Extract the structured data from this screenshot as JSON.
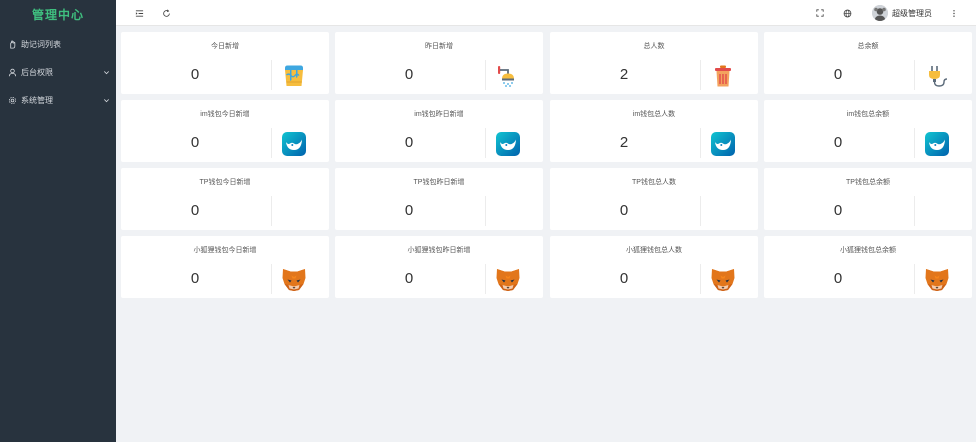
{
  "sidebar": {
    "brand": "管理中心",
    "items": [
      {
        "label": "助记词列表",
        "icon": "hand-icon",
        "has_children": false
      },
      {
        "label": "后台权限",
        "icon": "user-icon",
        "has_children": true
      },
      {
        "label": "系统管理",
        "icon": "gear-icon",
        "has_children": true
      }
    ]
  },
  "header": {
    "left_icons": [
      "menu-fold-icon",
      "refresh-icon"
    ],
    "right_icons": [
      "fullscreen-icon",
      "language-icon",
      "more-icon"
    ],
    "username": "超级管理员"
  },
  "cards": [
    {
      "title": "今日新增",
      "value": "0",
      "icon": "paint-bucket-icon"
    },
    {
      "title": "昨日新增",
      "value": "0",
      "icon": "shower-icon"
    },
    {
      "title": "总人数",
      "value": "2",
      "icon": "trash-bin-icon"
    },
    {
      "title": "总余额",
      "value": "0",
      "icon": "plug-icon"
    },
    {
      "title": "im钱包今日新增",
      "value": "0",
      "icon": "imtoken-icon"
    },
    {
      "title": "im钱包昨日新增",
      "value": "0",
      "icon": "imtoken-icon"
    },
    {
      "title": "im钱包总人数",
      "value": "2",
      "icon": "imtoken-icon"
    },
    {
      "title": "im钱包总余额",
      "value": "0",
      "icon": "imtoken-icon"
    },
    {
      "title": "TP钱包今日新增",
      "value": "0",
      "icon": ""
    },
    {
      "title": "TP钱包昨日新增",
      "value": "0",
      "icon": ""
    },
    {
      "title": "TP钱包总人数",
      "value": "0",
      "icon": ""
    },
    {
      "title": "TP钱包总余额",
      "value": "0",
      "icon": ""
    },
    {
      "title": "小狐狸钱包今日新增",
      "value": "0",
      "icon": "metamask-fox-icon"
    },
    {
      "title": "小狐狸钱包昨日新增",
      "value": "0",
      "icon": "metamask-fox-icon"
    },
    {
      "title": "小狐狸钱包总人数",
      "value": "0",
      "icon": "metamask-fox-icon"
    },
    {
      "title": "小狐狸钱包总余额",
      "value": "0",
      "icon": "metamask-fox-icon"
    }
  ],
  "colors": {
    "sidebar_bg": "#28333e",
    "brand_green": "#3fbf7f",
    "page_bg": "#f0f2f5",
    "imtoken_blue": "#1a9fd6",
    "fox_orange": "#e2761b"
  }
}
